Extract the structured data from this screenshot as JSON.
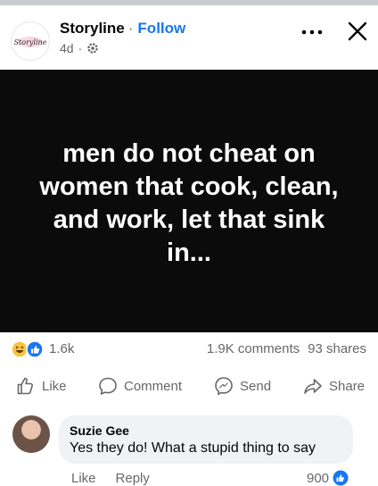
{
  "post": {
    "author": "Storyline",
    "separator": "·",
    "follow_label": "Follow",
    "age": "4d",
    "meta_separator": "·",
    "logo_text": "Storyline",
    "text": "men do not cheat on women that cook, clean, and work, let that sink in..."
  },
  "reactions": {
    "icons": [
      "haha-icon",
      "like-icon"
    ],
    "count": "1.6k",
    "comments": "1.9K comments",
    "shares": "93 shares"
  },
  "actions": {
    "like": "Like",
    "comment": "Comment",
    "send": "Send",
    "share": "Share"
  },
  "comment": {
    "author": "Suzie Gee",
    "text": "Yes they do! What a stupid thing to say",
    "like_label": "Like",
    "reply_label": "Reply",
    "likes": "900"
  },
  "colors": {
    "link_blue": "#1877f2",
    "secondary_text": "#65676b",
    "post_background": "#0b0b0b",
    "bubble_background": "#f0f2f5"
  }
}
